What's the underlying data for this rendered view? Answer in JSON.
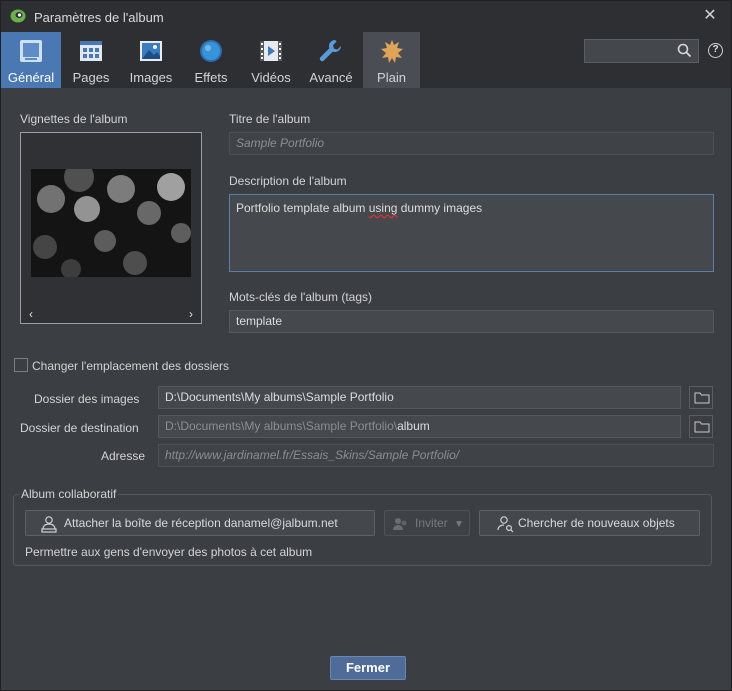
{
  "window": {
    "title": "Paramètres de l'album"
  },
  "tabs": [
    {
      "label": "Général",
      "icon": "general-icon"
    },
    {
      "label": "Pages",
      "icon": "pages-icon"
    },
    {
      "label": "Images",
      "icon": "images-icon"
    },
    {
      "label": "Effets",
      "icon": "effects-icon"
    },
    {
      "label": "Vidéos",
      "icon": "videos-icon"
    },
    {
      "label": "Avancé",
      "icon": "wrench-icon"
    },
    {
      "label": "Plain",
      "icon": "plain-skin-icon"
    }
  ],
  "search": {
    "value": "",
    "placeholder": ""
  },
  "help": {
    "glyph": "?"
  },
  "thumbnails": {
    "label": "Vignettes de l'album",
    "prev": "‹",
    "next": "›"
  },
  "album_title": {
    "label": "Titre de l'album",
    "placeholder": "Sample Portfolio"
  },
  "album_description": {
    "label": "Description de l'album",
    "text_before": "Portfolio template album ",
    "misspelled": "using",
    "text_after": " dummy images"
  },
  "keywords": {
    "label": "Mots-clés de l'album (tags)",
    "value": "template"
  },
  "change_folders": {
    "label": "Changer l'emplacement des dossiers",
    "checked": false
  },
  "image_folder": {
    "label": "Dossier des images",
    "value": "D:\\Documents\\My albums\\Sample Portfolio"
  },
  "destination_folder": {
    "label": "Dossier de destination",
    "value_prefix": "D:\\Documents\\My albums\\Sample Portfolio\\",
    "value_suffix": "album"
  },
  "address": {
    "label": "Adresse",
    "value": "http://www.jardinamel.fr/Essais_Skins/Sample Portfolio/"
  },
  "collaborative": {
    "title": "Album collaboratif",
    "attach_button": "Attacher la boîte de réception danamel@jalbum.net",
    "invite_button": "Inviter",
    "search_button": "Chercher de nouveaux objets",
    "note": "Permettre aux gens d'envoyer des photos à cet album"
  },
  "close_button": "Fermer",
  "colors": {
    "accent": "#4a78b3",
    "background": "#3b3e42",
    "titlebar": "#2d2f33",
    "primary_button": "#4f6c99"
  }
}
